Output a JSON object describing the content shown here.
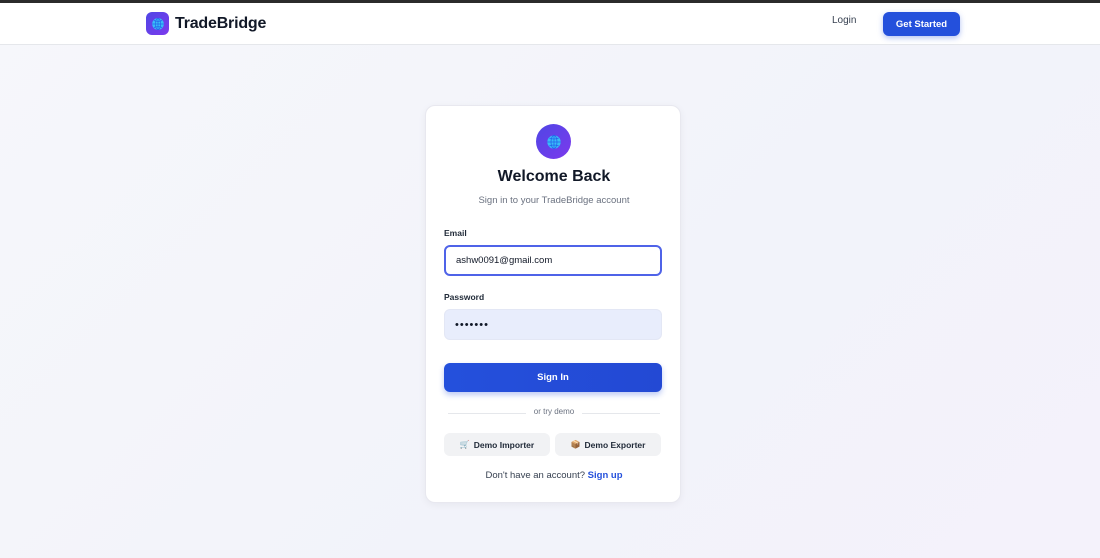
{
  "header": {
    "brand_name": "TradeBridge",
    "login_label": "Login",
    "cta_label": "Get Started"
  },
  "card": {
    "title": "Welcome Back",
    "subtitle": "Sign in to your TradeBridge account",
    "email_label": "Email",
    "email_value": "ashw0091@gmail.com",
    "password_label": "Password",
    "password_value": "•••••••",
    "signin_label": "Sign In",
    "divider_text": "or try demo",
    "demo_importer_label": "Demo Importer",
    "demo_importer_icon": "🛒",
    "demo_exporter_label": "Demo Exporter",
    "demo_exporter_icon": "📦",
    "signup_prompt": "Don't have an account?",
    "signup_link": "Sign up"
  },
  "icons": {
    "brand_logo": "globe-icon",
    "card_logo": "globe-icon",
    "demo_importer": "cart-icon",
    "demo_exporter": "package-icon"
  },
  "colors": {
    "accent": "#2450dc",
    "logo_gradient_start": "#4f46e5",
    "logo_gradient_end": "#7c3aed",
    "background": "#f4f5fa"
  }
}
